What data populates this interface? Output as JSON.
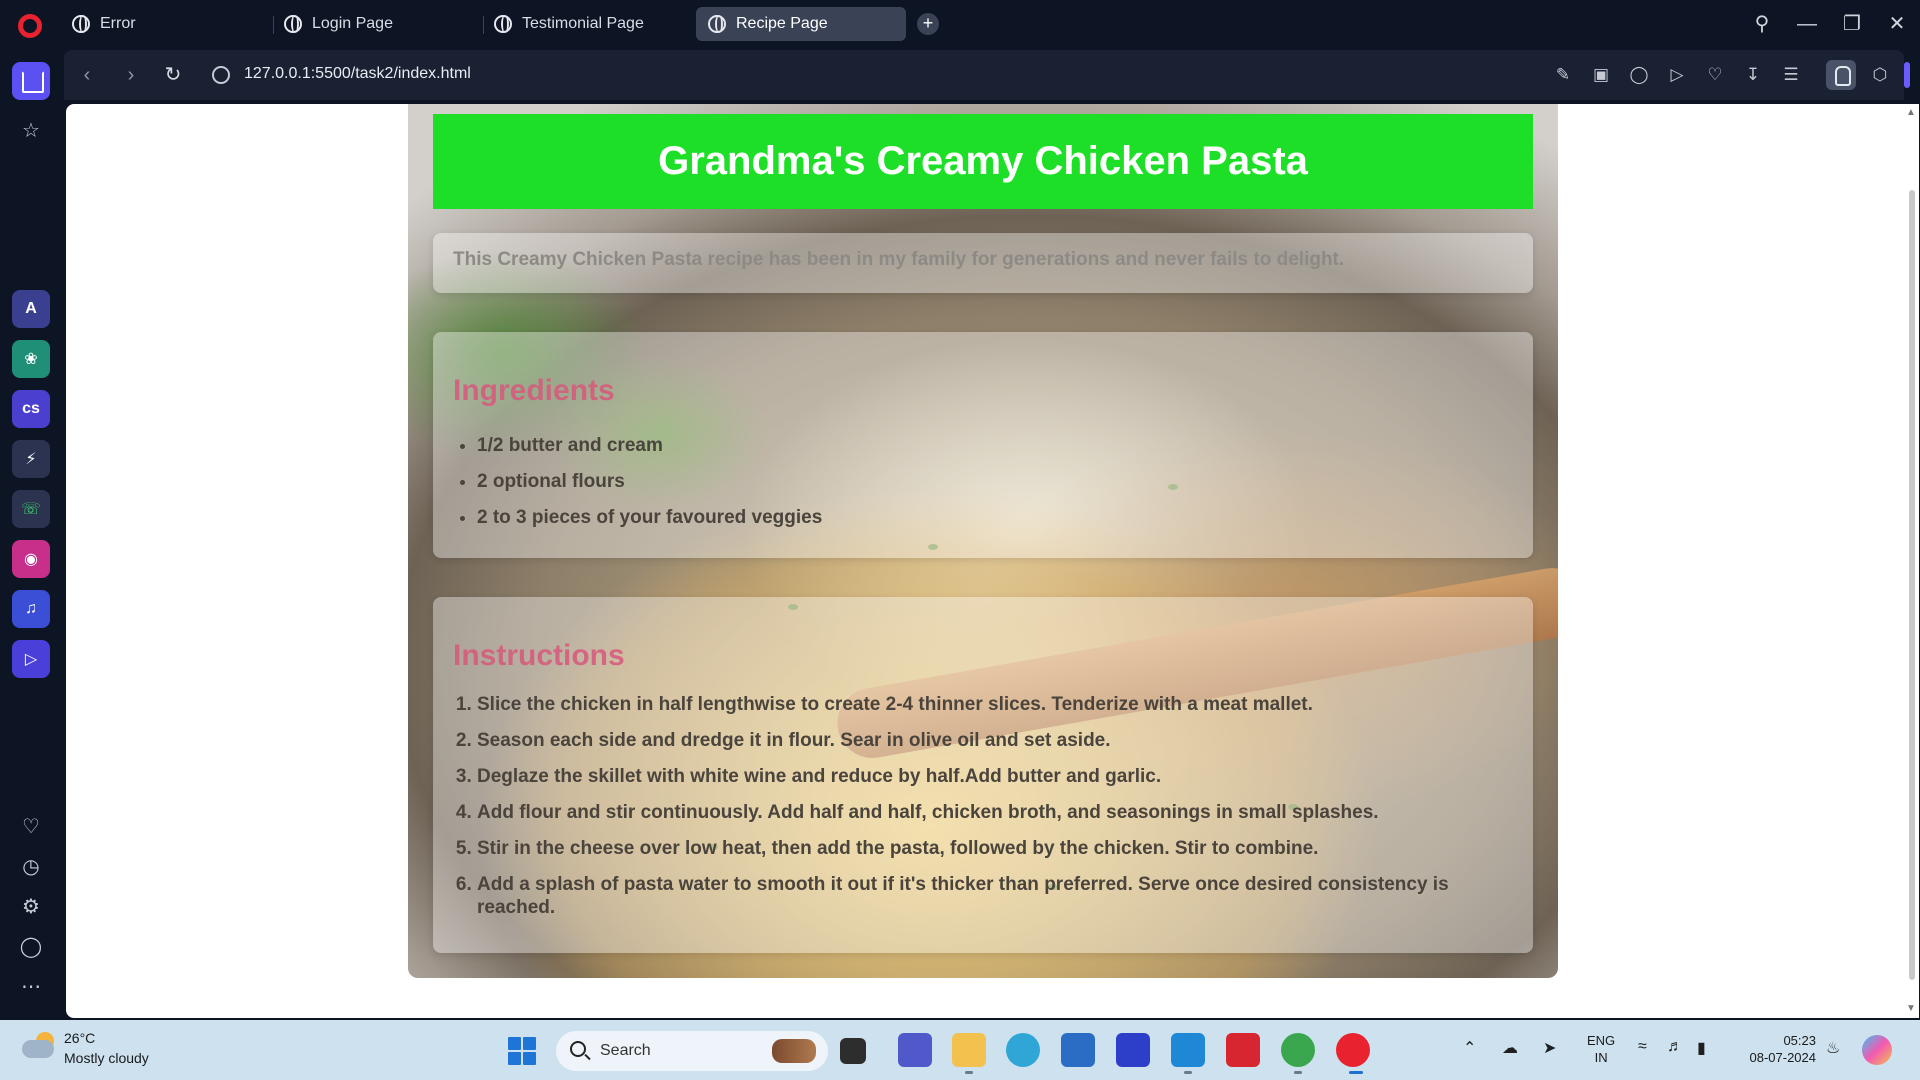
{
  "browser": {
    "tabs": [
      {
        "label": "Error",
        "active": false
      },
      {
        "label": "Login Page",
        "active": false
      },
      {
        "label": "Testimonial Page",
        "active": false
      },
      {
        "label": "Recipe Page",
        "active": true
      }
    ],
    "url": "127.0.0.1:5500/task2/index.html"
  },
  "page": {
    "title": "Grandma's Creamy Chicken Pasta",
    "intro": "This Creamy Chicken Pasta recipe has been in my family for generations and never fails to delight.",
    "ingredients": {
      "heading": "Ingredients",
      "items": [
        "1/2 butter and cream",
        "2 optional flours",
        "2 to 3 pieces of your favoured veggies"
      ]
    },
    "instructions": {
      "heading": "Instructions",
      "steps": [
        "Slice the chicken in half lengthwise to create 2-4 thinner slices. Tenderize with a meat mallet.",
        "Season each side and dredge it in flour. Sear in olive oil and set aside.",
        "Deglaze the skillet with white wine and reduce by half.Add butter and garlic.",
        "Add flour and stir continuously. Add half and half, chicken broth, and seasonings in small splashes.",
        "Stir in the cheese over low heat, then add the pasta, followed by the chicken. Stir to combine.",
        "Add a splash of pasta water to smooth it out if it's thicker than preferred. Serve once desired consistency is reached."
      ]
    },
    "colors": {
      "header_bg": "#1ddf27",
      "heading_color": "#d8587c"
    }
  },
  "taskbar": {
    "weather_temp": "26°C",
    "weather_desc": "Mostly cloudy",
    "search_label": "Search",
    "lang_line1": "ENG",
    "lang_line2": "IN",
    "time": "05:23",
    "date": "08-07-2024"
  }
}
